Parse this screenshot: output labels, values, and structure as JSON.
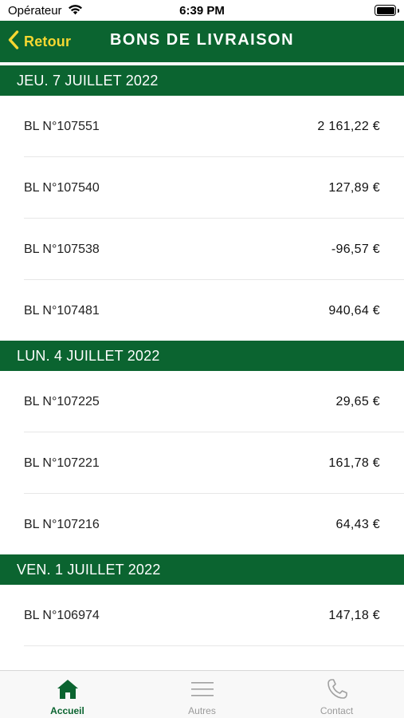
{
  "status_bar": {
    "carrier": "Opérateur",
    "time": "6:39 PM"
  },
  "header": {
    "back_label": "Retour",
    "title": "BONS DE LIVRAISON"
  },
  "colors": {
    "brand_green": "#0b6430",
    "accent_yellow": "#f5d731"
  },
  "sections": [
    {
      "date": "JEU. 7 JUILLET 2022",
      "rows": [
        {
          "label": "BL N°107551",
          "amount": "2 161,22 €"
        },
        {
          "label": "BL N°107540",
          "amount": "127,89 €"
        },
        {
          "label": "BL N°107538",
          "amount": "-96,57 €"
        },
        {
          "label": "BL N°107481",
          "amount": "940,64 €"
        }
      ]
    },
    {
      "date": "LUN. 4 JUILLET 2022",
      "rows": [
        {
          "label": "BL N°107225",
          "amount": "29,65 €"
        },
        {
          "label": "BL N°107221",
          "amount": "161,78 €"
        },
        {
          "label": "BL N°107216",
          "amount": "64,43 €"
        }
      ]
    },
    {
      "date": "VEN. 1 JUILLET 2022",
      "rows": [
        {
          "label": "BL N°106974",
          "amount": "147,18 €"
        }
      ]
    }
  ],
  "tab_bar": {
    "tabs": [
      {
        "label": "Accueil",
        "icon": "home-icon",
        "active": true
      },
      {
        "label": "Autres",
        "icon": "menu-icon",
        "active": false
      },
      {
        "label": "Contact",
        "icon": "phone-icon",
        "active": false
      }
    ]
  }
}
